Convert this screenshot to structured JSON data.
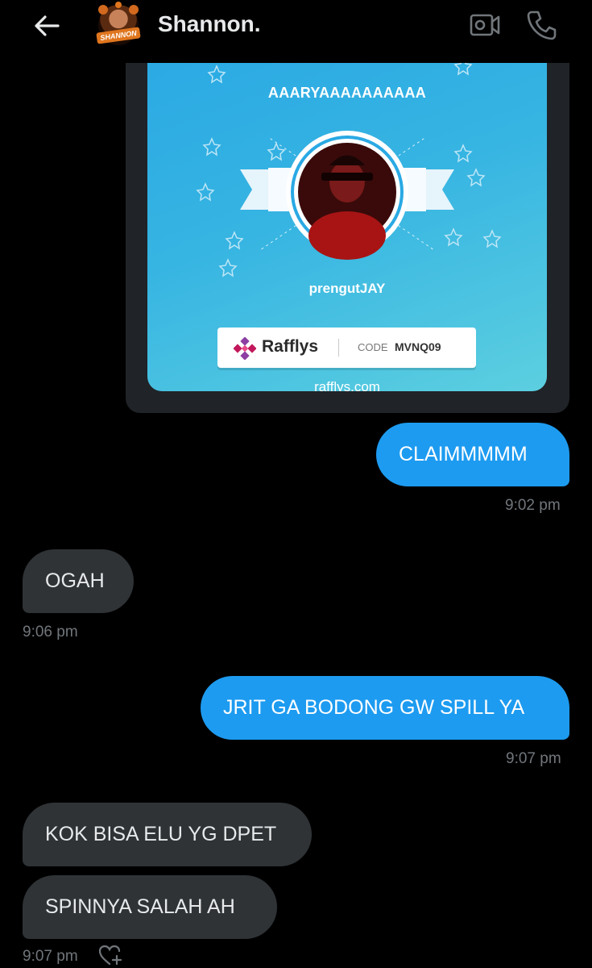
{
  "header": {
    "contact_name": "Shannon.",
    "avatar_badge": "SHANNON"
  },
  "shared_card": {
    "winner_top": "AAARYAAAAAAAAAA",
    "winner_name": "prengutJAY",
    "brand": "Rafflys",
    "code_label": "CODE",
    "code_value": "MVNQ09",
    "site": "rafflys.com"
  },
  "messages": [
    {
      "direction": "outgoing",
      "text": "CLAIMMMMM",
      "time": "9:02 pm"
    },
    {
      "direction": "incoming",
      "text": "OGAH",
      "time": "9:06 pm"
    },
    {
      "direction": "outgoing",
      "text": "JRIT GA BODONG GW SPILL YA",
      "time": "9:07 pm"
    },
    {
      "direction": "incoming",
      "text": "KOK BISA ELU YG DPET"
    },
    {
      "direction": "incoming",
      "text": "SPINNYA SALAH AH",
      "time": "9:07 pm"
    }
  ],
  "icons": {
    "back": "arrow-left-icon",
    "video": "video-camera-icon",
    "call": "phone-icon",
    "react": "heart-plus-icon"
  },
  "colors": {
    "background": "#000000",
    "outgoing_bubble": "#1d9bf0",
    "incoming_bubble": "#2f3336",
    "timestamp": "#71767b",
    "card_blue": "#2aa9e4"
  }
}
